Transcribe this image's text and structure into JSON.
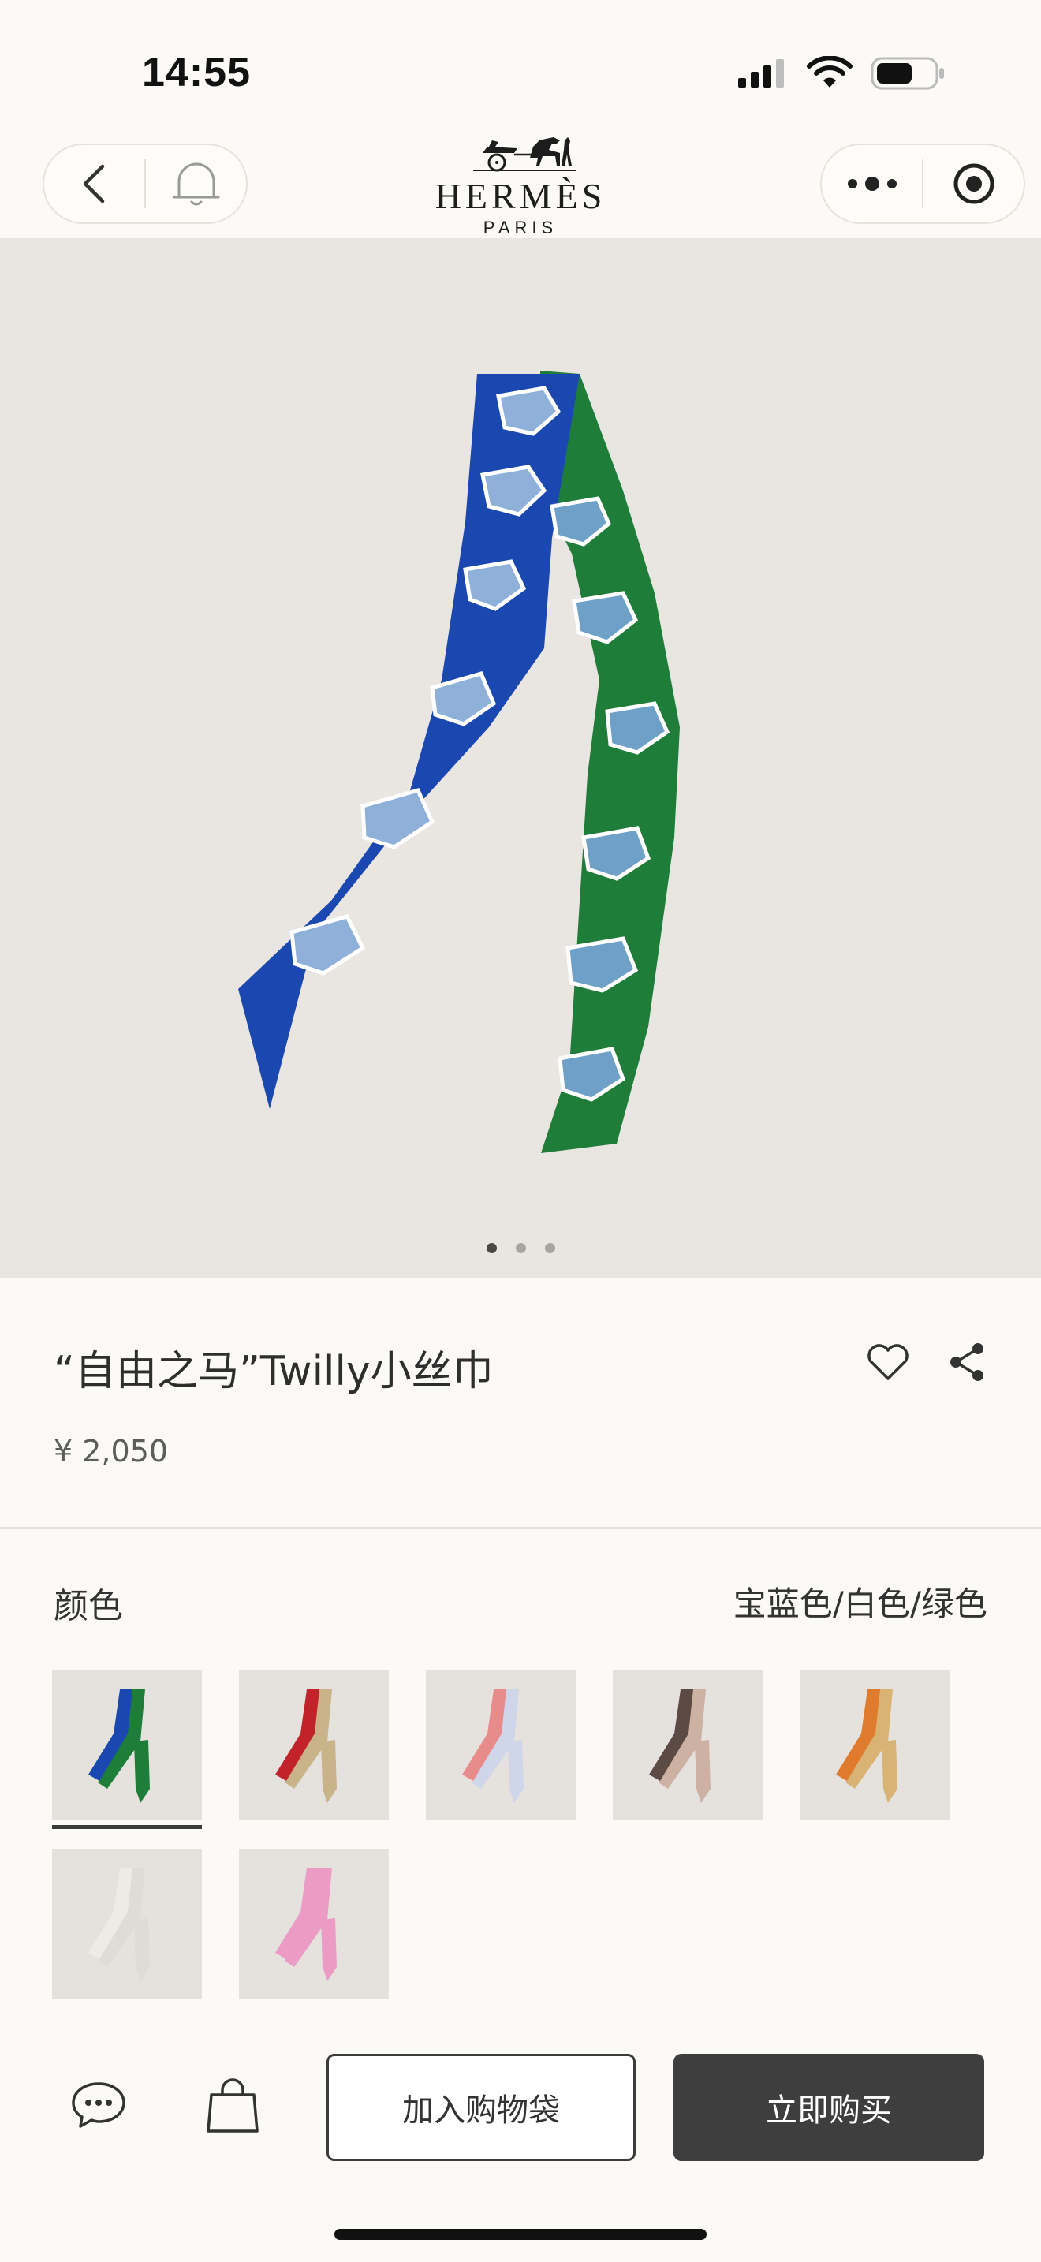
{
  "status_bar": {
    "time": "14:55"
  },
  "brand": {
    "name": "HERMÈS",
    "city": "PARIS"
  },
  "gallery": {
    "total_images": 3,
    "active_index": 0
  },
  "product": {
    "title": "“自由之马”Twilly小丝巾",
    "price": "¥ 2,050"
  },
  "color_section": {
    "label": "颜色",
    "selected_value": "宝蓝色/白色/绿色"
  },
  "swatches": [
    {
      "colors": [
        "#1b48b0",
        "#1f7d3a"
      ],
      "selected": true
    },
    {
      "colors": [
        "#c2232b",
        "#c9b48a"
      ],
      "selected": false
    },
    {
      "colors": [
        "#e88b8b",
        "#cfd6ea"
      ],
      "selected": false
    },
    {
      "colors": [
        "#5c4a44",
        "#cdb2a4"
      ],
      "selected": false
    },
    {
      "colors": [
        "#e07a2c",
        "#d9b374"
      ],
      "selected": false
    },
    {
      "colors": [
        "#ecebe6",
        "#dedcd4"
      ],
      "selected": false
    },
    {
      "colors": [
        "#ec9cc4",
        "#ec9cc4"
      ],
      "selected": false
    }
  ],
  "actions": {
    "add_to_bag": "加入购物袋",
    "buy_now": "立即购买"
  },
  "colors": {
    "background": "#fcfaf6",
    "hero_background": "#e9e6e1",
    "dark_button": "#3e3e3e"
  }
}
